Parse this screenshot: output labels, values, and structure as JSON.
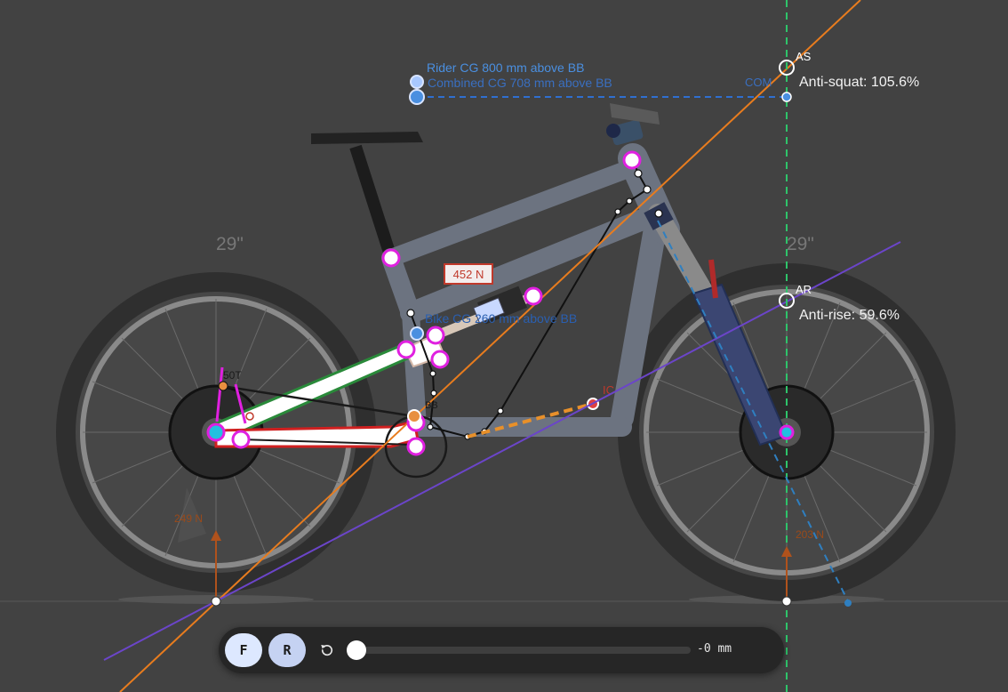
{
  "wheels": {
    "rear_size": "29\"",
    "front_size": "29\""
  },
  "cg": {
    "rider_label": "Rider CG 800 mm above BB",
    "combined_label": "Combined CG 708 mm above BB",
    "bike_label": "Bike CG 260 mm above BB",
    "combined_tag": "COM"
  },
  "points": {
    "as_label": "AS",
    "ar_label": "AR",
    "ic_label": "IC",
    "bb_label": "BB"
  },
  "readouts": {
    "anti_squat": "Anti-squat: 105.6%",
    "anti_rise": "Anti-rise: 59.6%",
    "shock_force": "452 N",
    "cog_teeth": "50T",
    "rear_force": "249 N",
    "front_force": "203 N"
  },
  "toolbar": {
    "front_button": "F",
    "rear_button": "R",
    "travel_readout": "-0 mm",
    "travel_value": 0
  },
  "colors": {
    "background": "#424242",
    "anti_squat_line": "#e87c1e",
    "anti_rise_line": "#6b45c9",
    "vertical_guide": "#2ec46a",
    "cg_blue": "#4a8fe0",
    "pivot_magenta": "#e020e0",
    "shock_label_red": "#c0392b",
    "chainstay_red": "#d02020",
    "upper_link_green": "#2a8a3a",
    "fork_blue": "#3a4a7a"
  }
}
